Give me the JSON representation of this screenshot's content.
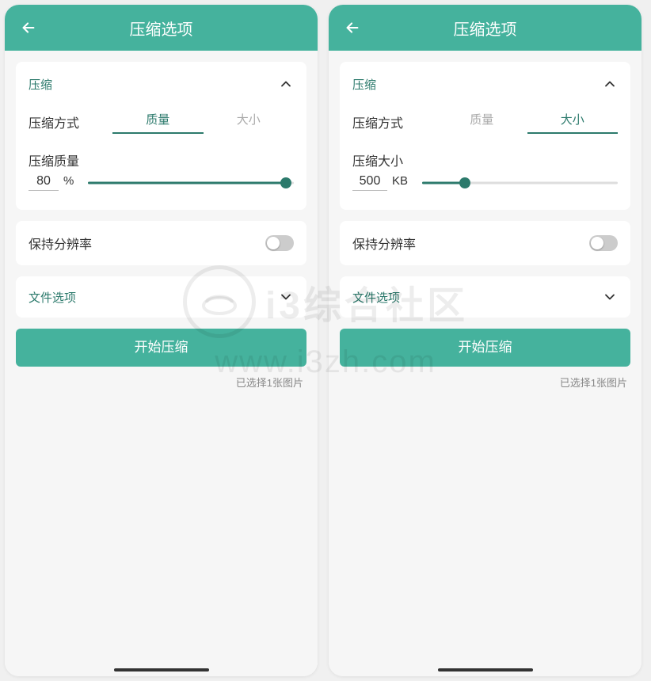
{
  "header": {
    "title": "压缩选项"
  },
  "section": {
    "compress": "压缩",
    "fileOptions": "文件选项"
  },
  "methodLabel": "压缩方式",
  "tabs": {
    "quality": "质量",
    "size": "大小"
  },
  "left": {
    "subLabel": "压缩质量",
    "value": "80",
    "unit": "%",
    "sliderPercent": 96
  },
  "right": {
    "subLabel": "压缩大小",
    "value": "500",
    "unit": "KB",
    "sliderPercent": 22
  },
  "keepResolution": "保持分辨率",
  "startBtn": "开始压缩",
  "selectedInfo": "已选择1张图片",
  "watermark": {
    "cn": "i3综合社区",
    "url": "www.i3zh.com"
  }
}
